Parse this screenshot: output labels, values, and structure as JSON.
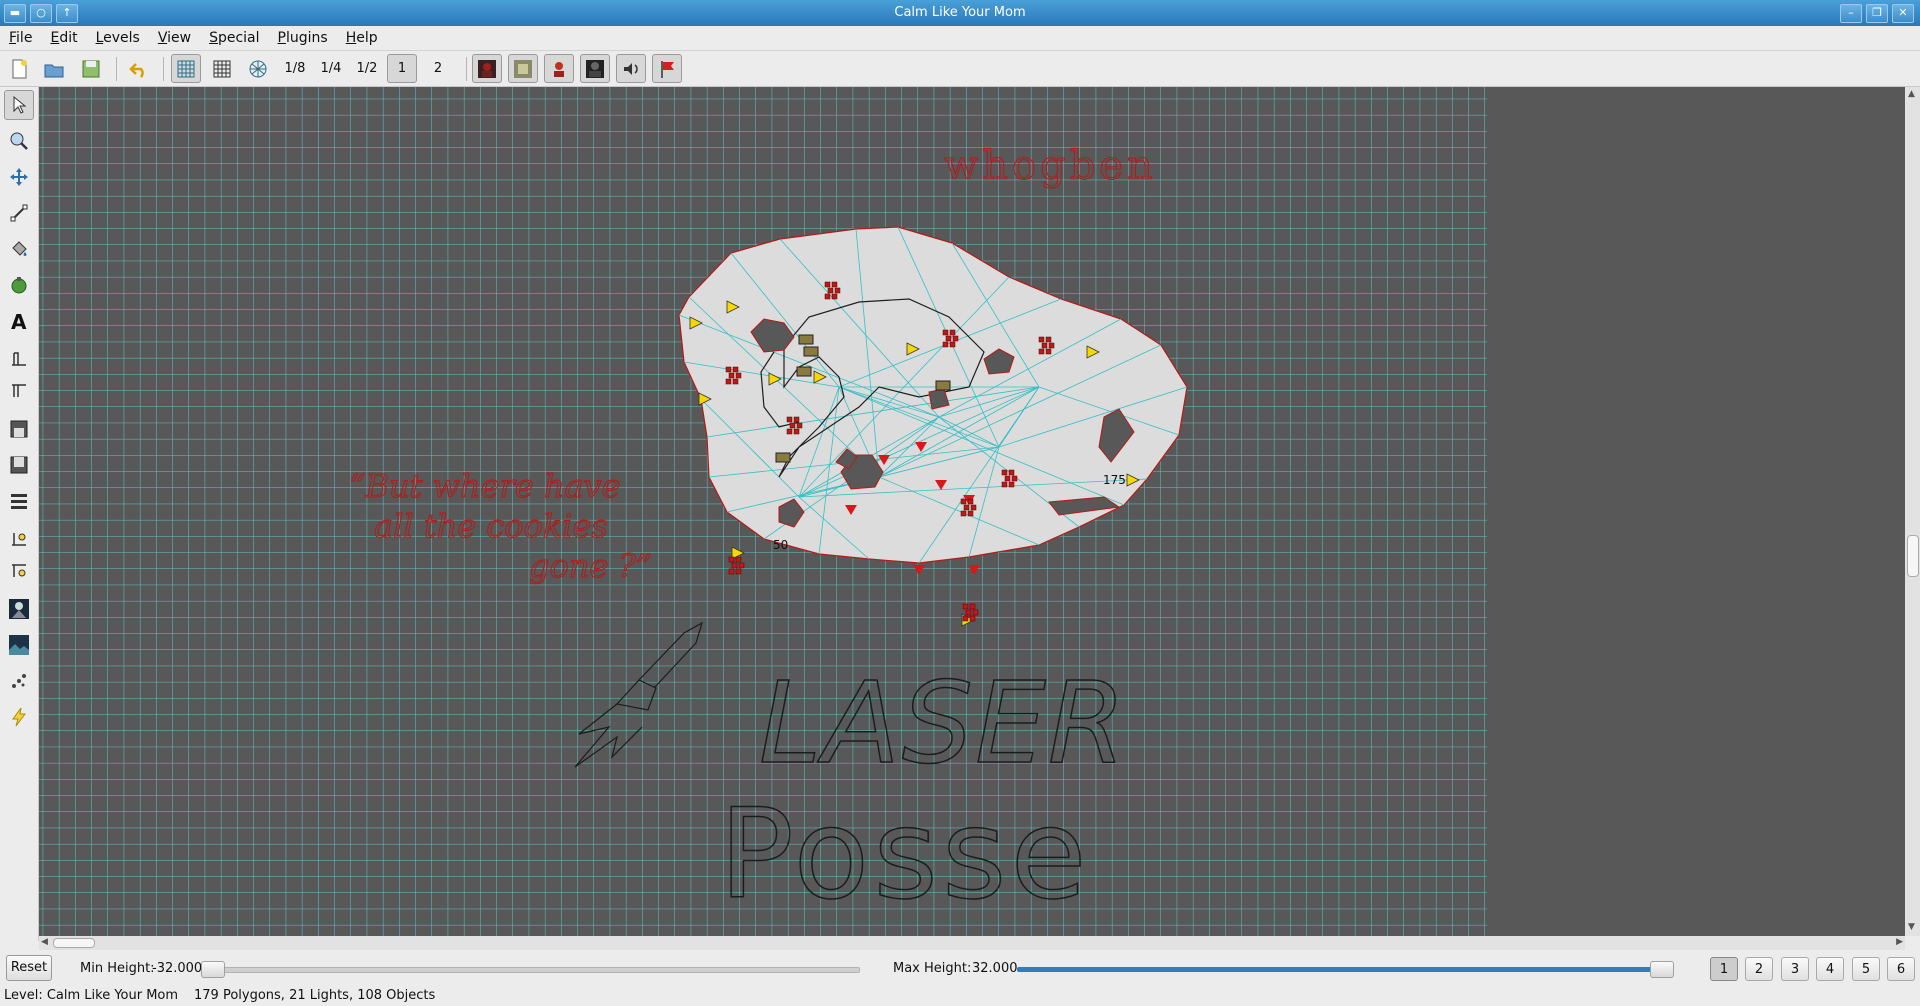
{
  "window": {
    "title": "Calm Like Your Mom"
  },
  "menu": [
    {
      "label": "File",
      "key": "F",
      "rest": "ile"
    },
    {
      "label": "Edit",
      "key": "E",
      "rest": "dit"
    },
    {
      "label": "Levels",
      "key": "L",
      "rest": "evels"
    },
    {
      "label": "View",
      "key": "V",
      "rest": "iew"
    },
    {
      "label": "Special",
      "key": "S",
      "rest": "pecial"
    },
    {
      "label": "Plugins",
      "key": "P",
      "rest": "lugins"
    },
    {
      "label": "Help",
      "key": "H",
      "rest": "elp"
    }
  ],
  "toolbar": {
    "zoom_labels": [
      "1/8",
      "1/4",
      "1/2",
      "1",
      "2"
    ],
    "selected_zoom": "1"
  },
  "icons": {
    "toolbar": [
      "new-file-icon",
      "open-folder-icon",
      "save-icon",
      "undo-icon",
      "grid-icon",
      "grid-small-icon",
      "snap-grid-icon",
      "monster-icon",
      "item-icon",
      "player-icon",
      "light-icon",
      "sound-icon",
      "goal-flag-icon"
    ],
    "tools": [
      "select-arrow-icon",
      "zoom-icon",
      "pan-icon",
      "line-icon",
      "fill-icon",
      "object-icon",
      "text-icon",
      "floor-height-icon",
      "ceiling-height-icon",
      "floor-texture-icon",
      "ceiling-texture-icon",
      "lights-icon",
      "floor-light-icon",
      "ceiling-light-icon",
      "media-icon",
      "landscape-icon",
      "sound-source-icon",
      "lightning-icon"
    ]
  },
  "map": {
    "annotations": {
      "author": "whogben",
      "quote_line1": "“But where have",
      "quote_line2": "all the cookies",
      "quote_line3": "gone ?”",
      "logo_word1": "LASER",
      "logo_word2": "Posse"
    },
    "labels": [
      "175",
      "50"
    ]
  },
  "height_filter": {
    "reset_label": "Reset",
    "min_label": "Min Height:",
    "min_value": "-32.000",
    "max_label": "Max Height:",
    "max_value": "32.000"
  },
  "pages": [
    "1",
    "2",
    "3",
    "4",
    "5",
    "6"
  ],
  "active_page": "1",
  "status": {
    "level": "Level: Calm Like Your Mom",
    "counts": "179 Polygons, 21 Lights, 108 Objects"
  },
  "colors": {
    "accent": "#2e7fc0",
    "grid": "#5fc7c7",
    "canvas": "#585858",
    "polygon": "#dcdcdc",
    "line": "#b81818"
  }
}
